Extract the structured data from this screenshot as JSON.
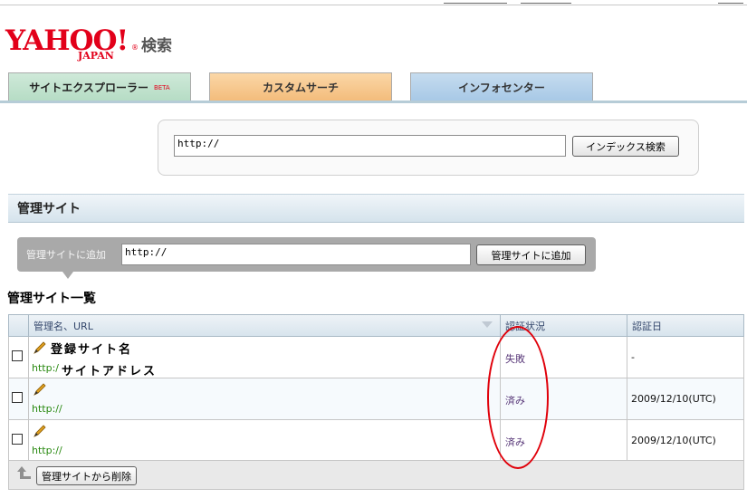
{
  "header": {
    "logo_text": "YAHOO!",
    "logo_sub": "JAPAN",
    "logo_registered": "®",
    "logo_search": "検索"
  },
  "tabs": [
    {
      "label": "サイトエクスプローラー",
      "badge": "BETA"
    },
    {
      "label": "カスタムサーチ"
    },
    {
      "label": "インフォセンター"
    }
  ],
  "search": {
    "value": "http://",
    "button_label": "インデックス検索"
  },
  "section": {
    "title": "管理サイト"
  },
  "add_site": {
    "label": "管理サイトに追加",
    "value": "http://",
    "button_label": "管理サイトに追加"
  },
  "list": {
    "title": "管理サイト一覧",
    "columns": [
      "管理名、URL",
      "認証状況",
      "認証日"
    ],
    "rows": [
      {
        "name": "登録サイト名",
        "url": "http:/",
        "url_suffix": "サイトアドレス",
        "status": "失敗",
        "date": "-"
      },
      {
        "name": "",
        "url": "http://",
        "url_suffix": "",
        "status": "済み",
        "date": "2009/12/10(UTC)"
      },
      {
        "name": "",
        "url": "http://",
        "url_suffix": "",
        "status": "済み",
        "date": "2009/12/10(UTC)"
      }
    ],
    "delete_button_label": "管理サイトから削除"
  },
  "colors": {
    "brand_red": "#e2001a",
    "link_green": "#2a8a12",
    "annotation_red": "#e0000a"
  }
}
